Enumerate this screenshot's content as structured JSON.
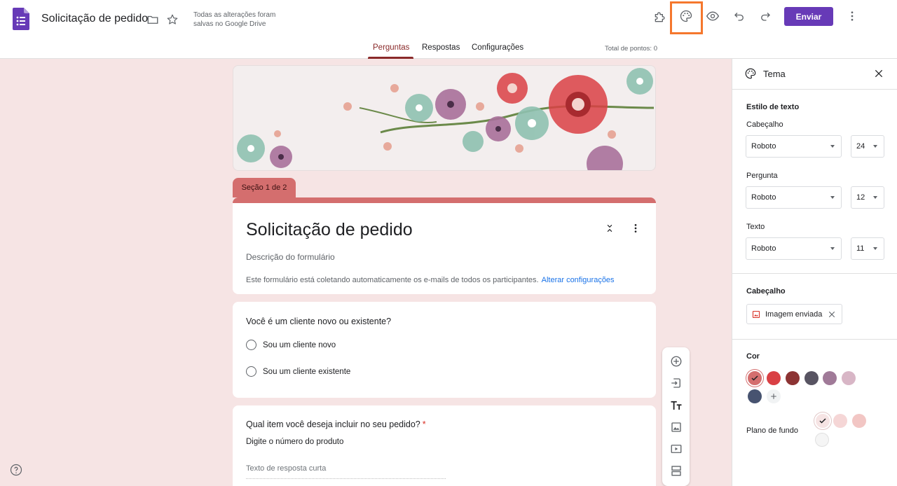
{
  "app": {
    "doc_title": "Solicitação de pedido",
    "save_status": "Todas as alterações foram salvas no Google Drive",
    "send_label": "Enviar"
  },
  "tabs": [
    {
      "label": "Perguntas",
      "active": true
    },
    {
      "label": "Respostas",
      "active": false
    },
    {
      "label": "Configurações",
      "active": false
    }
  ],
  "total_points": "Total de pontos: 0",
  "form": {
    "section_label": "Seção 1 de 2",
    "title": "Solicitação de pedido",
    "description": "Descrição do formulário",
    "email_note": "Este formulário está coletando automaticamente os e-mails de todos os participantes.",
    "email_link": "Alterar configurações"
  },
  "questions": [
    {
      "title": "Você é um cliente novo ou existente?",
      "required": false,
      "options": [
        "Sou um cliente novo",
        "Sou um cliente existente"
      ]
    },
    {
      "title": "Qual item você deseja incluir no seu pedido?",
      "required": true,
      "required_mark": "*",
      "subtitle": "Digite o número do produto",
      "placeholder": "Texto de resposta curta"
    }
  ],
  "toolbar_icons": [
    "add-question-icon",
    "import-questions-icon",
    "add-title-icon",
    "add-image-icon",
    "add-video-icon",
    "add-section-icon"
  ],
  "theme_panel": {
    "title": "Tema",
    "text_style_heading": "Estilo de texto",
    "header_label": "Cabeçalho",
    "header_font": "Roboto",
    "header_size": "24",
    "question_label": "Pergunta",
    "question_font": "Roboto",
    "question_size": "12",
    "text_label": "Texto",
    "text_font": "Roboto",
    "text_size": "11",
    "header_image_heading": "Cabeçalho",
    "header_image_chip": "Imagem enviada",
    "color_heading": "Cor",
    "colors": [
      "#d46e6e",
      "#d94044",
      "#8c3333",
      "#585462",
      "#a07a98",
      "#d8b6c6",
      "#475370"
    ],
    "selected_color": "#d46e6e",
    "background_label": "Plano de fundo",
    "backgrounds": [
      "#f6e4e4",
      "#f5d6d6",
      "#f2c6c4",
      "#f5f5f5"
    ],
    "selected_background": "#f6e4e4"
  }
}
